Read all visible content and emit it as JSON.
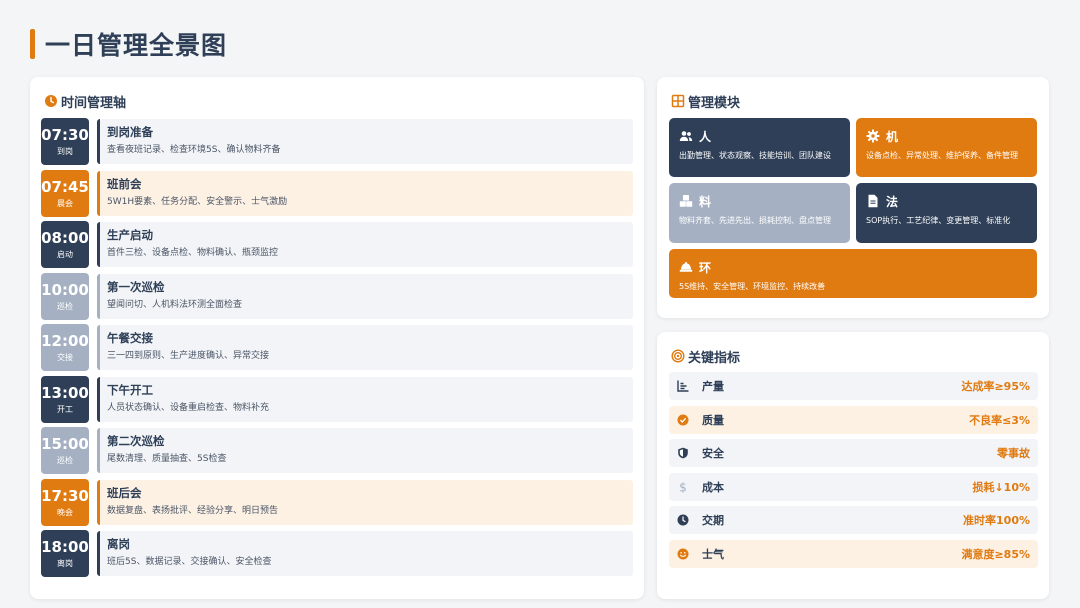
{
  "page": {
    "title": "一日管理全景图"
  },
  "timeline": {
    "heading": "时间管理轴",
    "items": [
      {
        "time": "07:30",
        "tag": "到岗",
        "title": "到岗准备",
        "desc": "查看夜班记录、检查环境5S、确认物料齐备",
        "style": "dark"
      },
      {
        "time": "07:45",
        "tag": "晨会",
        "title": "班前会",
        "desc": "5W1H要素、任务分配、安全警示、士气激励",
        "style": "orange"
      },
      {
        "time": "08:00",
        "tag": "启动",
        "title": "生产启动",
        "desc": "首件三检、设备点检、物料确认、瓶颈监控",
        "style": "dark"
      },
      {
        "time": "10:00",
        "tag": "巡检",
        "title": "第一次巡检",
        "desc": "望闻问切、人机料法环测全面检查",
        "style": "gray"
      },
      {
        "time": "12:00",
        "tag": "交接",
        "title": "午餐交接",
        "desc": "三一四到原则、生产进度确认、异常交接",
        "style": "gray"
      },
      {
        "time": "13:00",
        "tag": "开工",
        "title": "下午开工",
        "desc": "人员状态确认、设备重启检查、物料补充",
        "style": "dark"
      },
      {
        "time": "15:00",
        "tag": "巡检",
        "title": "第二次巡检",
        "desc": "尾数清理、质量抽查、5S检查",
        "style": "gray"
      },
      {
        "time": "17:30",
        "tag": "晚会",
        "title": "班后会",
        "desc": "数据复盘、表扬批评、经验分享、明日预告",
        "style": "orange"
      },
      {
        "time": "18:00",
        "tag": "离岗",
        "title": "离岗",
        "desc": "班后5S、数据记录、交接确认、安全检查",
        "style": "dark"
      }
    ]
  },
  "modules": {
    "heading": "管理模块",
    "items": [
      {
        "name": "人",
        "icon": "users-icon",
        "desc": "出勤管理、状态观察、技能培训、团队建设"
      },
      {
        "name": "机",
        "icon": "gear-icon",
        "desc": "设备点检、异常处理、维护保养、备件管理"
      },
      {
        "name": "料",
        "icon": "boxes-icon",
        "desc": "物料齐套、先进先出、损耗控制、盘点管理"
      },
      {
        "name": "法",
        "icon": "document-icon",
        "desc": "SOP执行、工艺纪律、变更管理、标准化"
      },
      {
        "name": "环",
        "icon": "helmet-icon",
        "desc": "5S维持、安全管理、环境监控、持续改善"
      }
    ]
  },
  "kpi": {
    "heading": "关键指标",
    "items": [
      {
        "name": "产量",
        "value": "达成率≥95%",
        "icon": "chart-icon"
      },
      {
        "name": "质量",
        "value": "不良率≤3%",
        "icon": "check-circle-icon"
      },
      {
        "name": "安全",
        "value": "零事故",
        "icon": "shield-icon"
      },
      {
        "name": "成本",
        "value": "损耗↓10%",
        "icon": "dollar-icon"
      },
      {
        "name": "交期",
        "value": "准时率100%",
        "icon": "clock-icon"
      },
      {
        "name": "士气",
        "value": "满意度≥85%",
        "icon": "smile-icon"
      }
    ]
  },
  "colors": {
    "navy": "#2e3f57",
    "orange": "#e07b12",
    "gray": "#a5b1c3",
    "light": "#f2f4f7",
    "cream": "#fdf1e4"
  }
}
